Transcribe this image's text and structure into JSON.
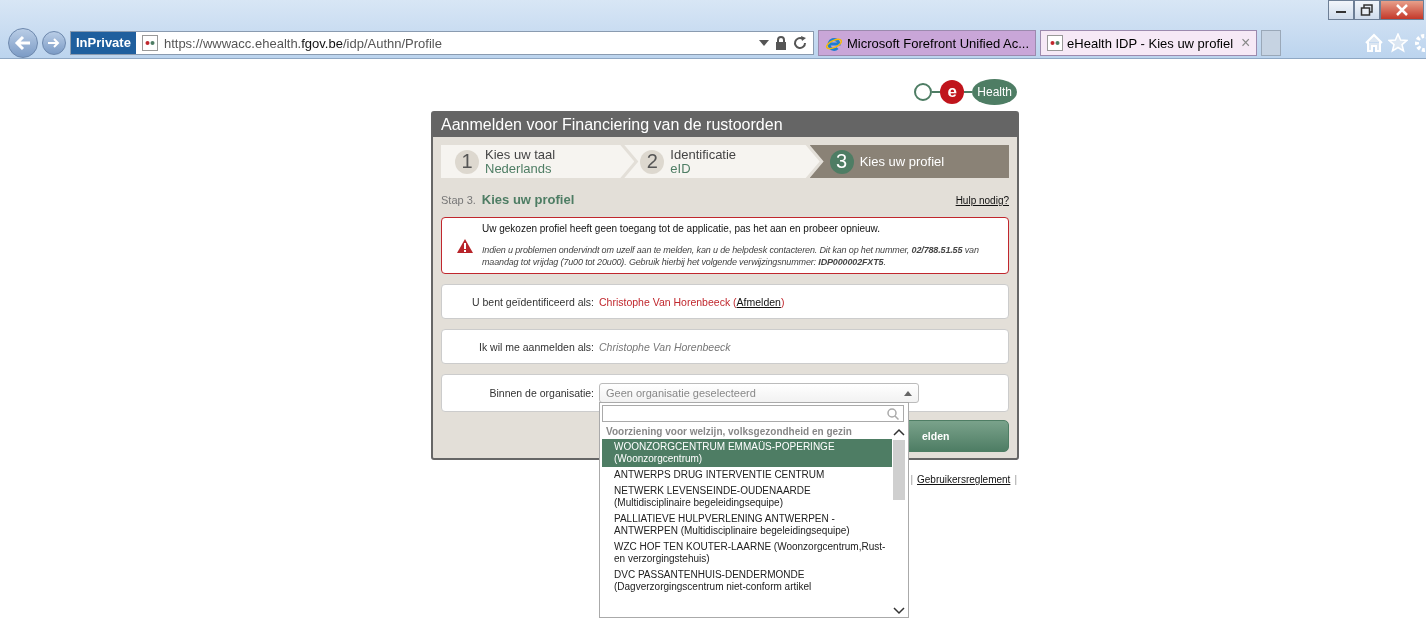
{
  "browser": {
    "private_badge": "InPrivate",
    "url": {
      "scheme": "https://",
      "host_prefix": "wwwacc.ehealth.",
      "host": "fgov.be",
      "path": "/idp/Authn/Profile"
    },
    "tabs": [
      {
        "title": "Microsoft Forefront Unified Ac...",
        "selected": false,
        "kind": "ie"
      },
      {
        "title": "eHealth IDP - Kies uw profiel",
        "selected": true,
        "kind": "ehealth",
        "close": "×"
      }
    ]
  },
  "logo": {
    "letter": "e",
    "word": "Health"
  },
  "panel": {
    "title": "Aanmelden voor Financiering van de rustoorden",
    "steps": [
      {
        "number": "1",
        "title": "Kies uw taal",
        "subtitle": "Nederlands",
        "selected": false
      },
      {
        "number": "2",
        "title": "Identificatie",
        "subtitle": "eID",
        "selected": false
      },
      {
        "number": "3",
        "title": "Kies uw profiel",
        "selected": true
      }
    ],
    "step_prefix": "Stap 3.",
    "step_title": "Kies uw profiel",
    "help_link": "Hulp nodig?",
    "alert": {
      "message": "Uw gekozen profiel heeft geen toegang tot de applicatie, pas het aan en probeer opnieuw.",
      "details": "Indien u problemen ondervindt om uzelf aan te melden, kan u de helpdesk contacteren. Dit kan op het nummer, **02/788.51.55** van maandag tot vrijdag (7u00 tot 20u00). Gebruik hierbij het volgende verwijzingsnummer: **IDP000002FXT5**."
    },
    "identified": {
      "label": "U bent geïdentificeerd als:",
      "name": "Christophe Van Horenbeeck",
      "open": " (",
      "link": "Afmelden",
      "close": ")"
    },
    "login_as": {
      "label": "Ik wil me aanmelden als:",
      "value": "Christophe Van Horenbeeck"
    },
    "organisation": {
      "label": "Binnen de organisatie:",
      "placeholder": "Geen organisatie geselecteerd",
      "expanded": true,
      "group": "Voorziening voor welzijn, volksgezondheid en gezin",
      "options": [
        {
          "lines": [
            "WOONZORGCENTRUM EMMAÜS-POPERINGE",
            "(Woonzorgcentrum)"
          ],
          "selected": true
        },
        {
          "lines": [
            "ANTWERPS DRUG INTERVENTIE CENTRUM"
          ],
          "selected": false
        },
        {
          "lines": [
            "NETWERK LEVENSEINDE-OUDENAARDE",
            "(Multidisciplinaire begeleidingsequipe)"
          ],
          "selected": false
        },
        {
          "lines": [
            "PALLIATIEVE HULPVERLENING ANTWERPEN -",
            "ANTWERPEN (Multidisciplinaire begeleidingsequipe)"
          ],
          "selected": false
        },
        {
          "lines": [
            "WZC HOF TEN KOUTER-LAARNE (Woonzorgcentrum,Rust-",
            "en verzorgingstehuis)"
          ],
          "selected": false
        },
        {
          "lines": [
            "DVC PASSANTENHUIS-DENDERMONDE",
            "(Dagverzorgingscentrum niet-conform artikel"
          ],
          "selected": false
        }
      ]
    },
    "submit": "elden"
  },
  "footer": {
    "sep_left": "|",
    "link": "Gebruikersreglement",
    "sep_right": "|"
  }
}
